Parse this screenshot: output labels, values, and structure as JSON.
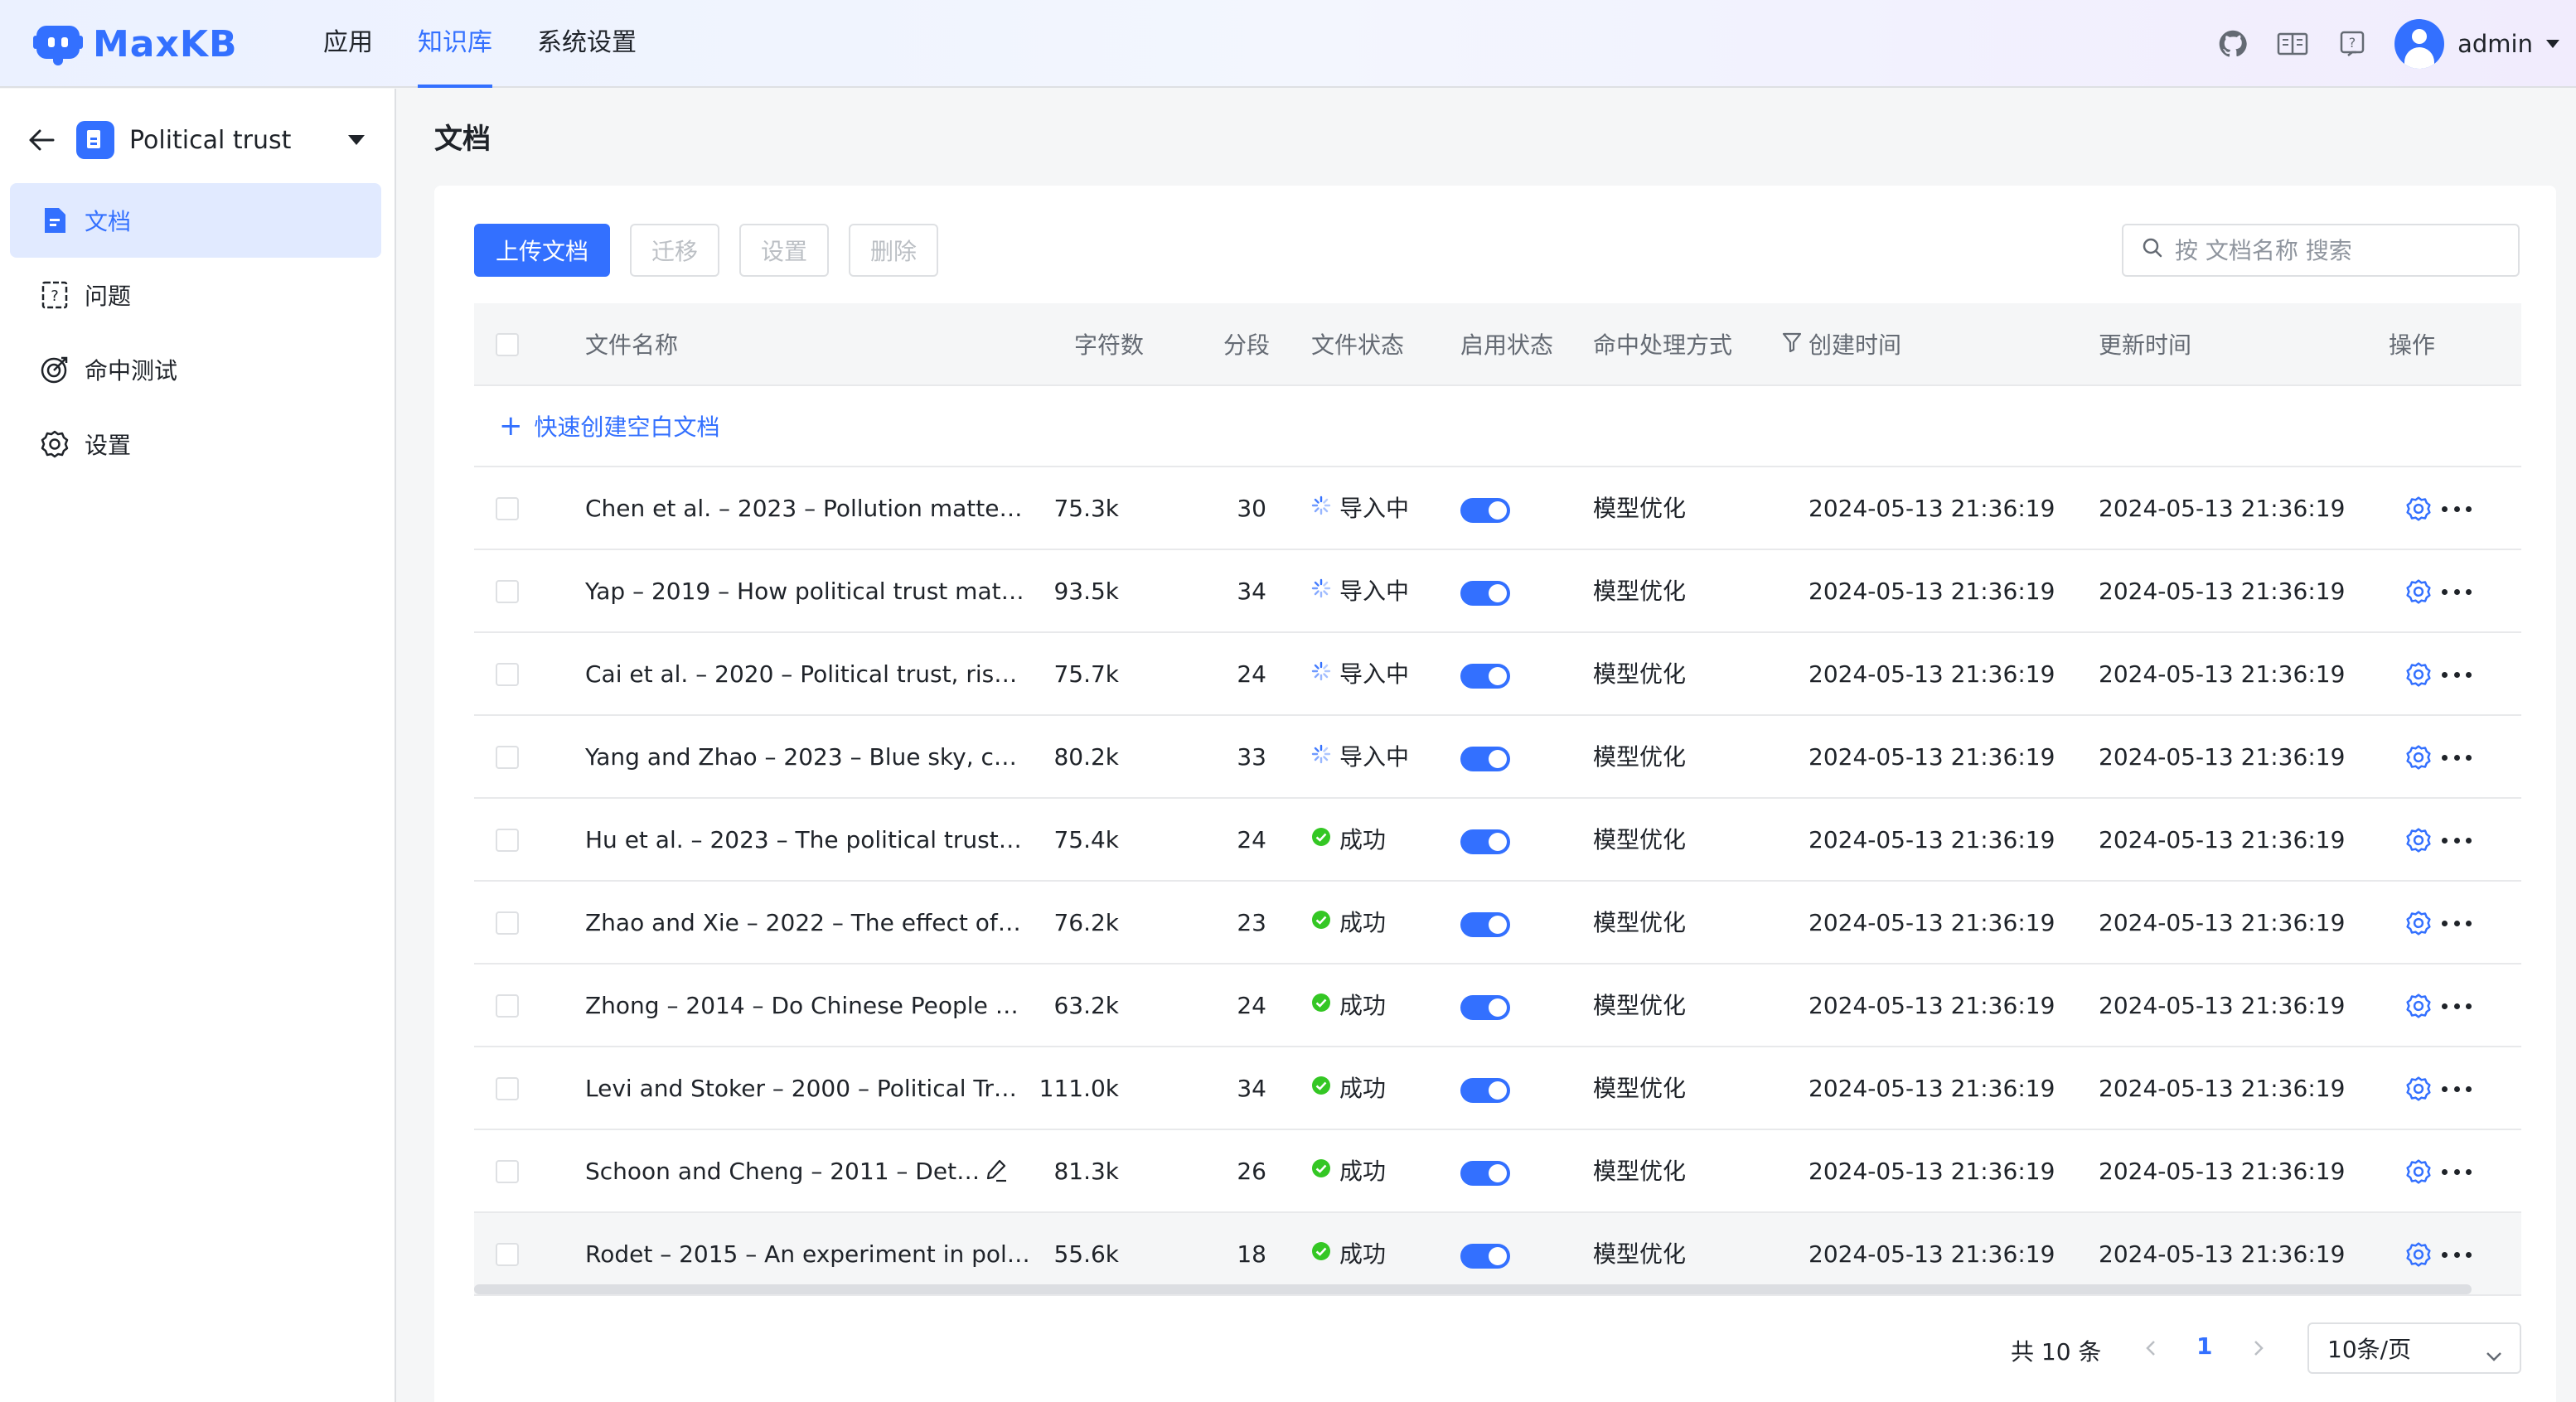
{
  "app": {
    "logo_text": "MaxKB",
    "nav": [
      "应用",
      "知识库",
      "系统设置"
    ],
    "active_nav": "知识库",
    "user": "admin"
  },
  "colors": {
    "accent": "#3370ff",
    "success": "#34c724"
  },
  "sidebar": {
    "kb_name": "Political trust",
    "items": [
      {
        "label": "文档",
        "icon": "document-icon",
        "active": true
      },
      {
        "label": "问题",
        "icon": "question-icon",
        "active": false
      },
      {
        "label": "命中测试",
        "icon": "target-icon",
        "active": false
      },
      {
        "label": "设置",
        "icon": "gear-icon",
        "active": false
      }
    ]
  },
  "page_title": "文档",
  "toolbar": {
    "upload": "上传文档",
    "migrate": "迁移",
    "settings": "设置",
    "delete": "删除",
    "search_placeholder": "按 文档名称 搜索"
  },
  "table": {
    "headers": {
      "name": "文件名称",
      "chars": "字符数",
      "segments": "分段",
      "file_status": "文件状态",
      "enabled": "启用状态",
      "hit_mode": "命中处理方式",
      "created": "创建时间",
      "updated": "更新时间",
      "ops": "操作"
    },
    "quick_create": "快速创建空白文档",
    "rows": [
      {
        "name": "Chen et al. – 2023 – Pollution matte…",
        "chars": "75.3k",
        "segments": "30",
        "status": "导入中",
        "status_type": "importing",
        "enabled": true,
        "hit_mode": "模型优化",
        "created": "2024-05-13 21:36:19",
        "updated": "2024-05-13 21:36:19"
      },
      {
        "name": "Yap – 2019 – How political trust mat…",
        "chars": "93.5k",
        "segments": "34",
        "status": "导入中",
        "status_type": "importing",
        "enabled": true,
        "hit_mode": "模型优化",
        "created": "2024-05-13 21:36:19",
        "updated": "2024-05-13 21:36:19"
      },
      {
        "name": "Cai et al. – 2020 – Political trust, ris…",
        "chars": "75.7k",
        "segments": "24",
        "status": "导入中",
        "status_type": "importing",
        "enabled": true,
        "hit_mode": "模型优化",
        "created": "2024-05-13 21:36:19",
        "updated": "2024-05-13 21:36:19"
      },
      {
        "name": "Yang and Zhao – 2023 – Blue sky, c…",
        "chars": "80.2k",
        "segments": "33",
        "status": "导入中",
        "status_type": "importing",
        "enabled": true,
        "hit_mode": "模型优化",
        "created": "2024-05-13 21:36:19",
        "updated": "2024-05-13 21:36:19"
      },
      {
        "name": "Hu et al. – 2023 – The political trust…",
        "chars": "75.4k",
        "segments": "24",
        "status": "成功",
        "status_type": "success",
        "enabled": true,
        "hit_mode": "模型优化",
        "created": "2024-05-13 21:36:19",
        "updated": "2024-05-13 21:36:19"
      },
      {
        "name": "Zhao and Xie – 2022 – The effect of…",
        "chars": "76.2k",
        "segments": "23",
        "status": "成功",
        "status_type": "success",
        "enabled": true,
        "hit_mode": "模型优化",
        "created": "2024-05-13 21:36:19",
        "updated": "2024-05-13 21:36:19"
      },
      {
        "name": "Zhong – 2014 – Do Chinese People …",
        "chars": "63.2k",
        "segments": "24",
        "status": "成功",
        "status_type": "success",
        "enabled": true,
        "hit_mode": "模型优化",
        "created": "2024-05-13 21:36:19",
        "updated": "2024-05-13 21:36:19"
      },
      {
        "name": "Levi and Stoker – 2000 – Political Tr…",
        "chars": "111.0k",
        "segments": "34",
        "status": "成功",
        "status_type": "success",
        "enabled": true,
        "hit_mode": "模型优化",
        "created": "2024-05-13 21:36:19",
        "updated": "2024-05-13 21:36:19"
      },
      {
        "name": "Schoon and Cheng – 2011 – Det…",
        "chars": "81.3k",
        "segments": "26",
        "status": "成功",
        "status_type": "success",
        "enabled": true,
        "hit_mode": "模型优化",
        "created": "2024-05-13 21:36:19",
        "updated": "2024-05-13 21:36:19",
        "editable": true
      },
      {
        "name": "Rodet – 2015 – An experiment in pol…",
        "chars": "55.6k",
        "segments": "18",
        "status": "成功",
        "status_type": "success",
        "enabled": true,
        "hit_mode": "模型优化",
        "created": "2024-05-13 21:36:19",
        "updated": "2024-05-13 21:36:19"
      }
    ]
  },
  "pagination": {
    "total": "共 10 条",
    "current_page": "1",
    "page_size": "10条/页"
  }
}
